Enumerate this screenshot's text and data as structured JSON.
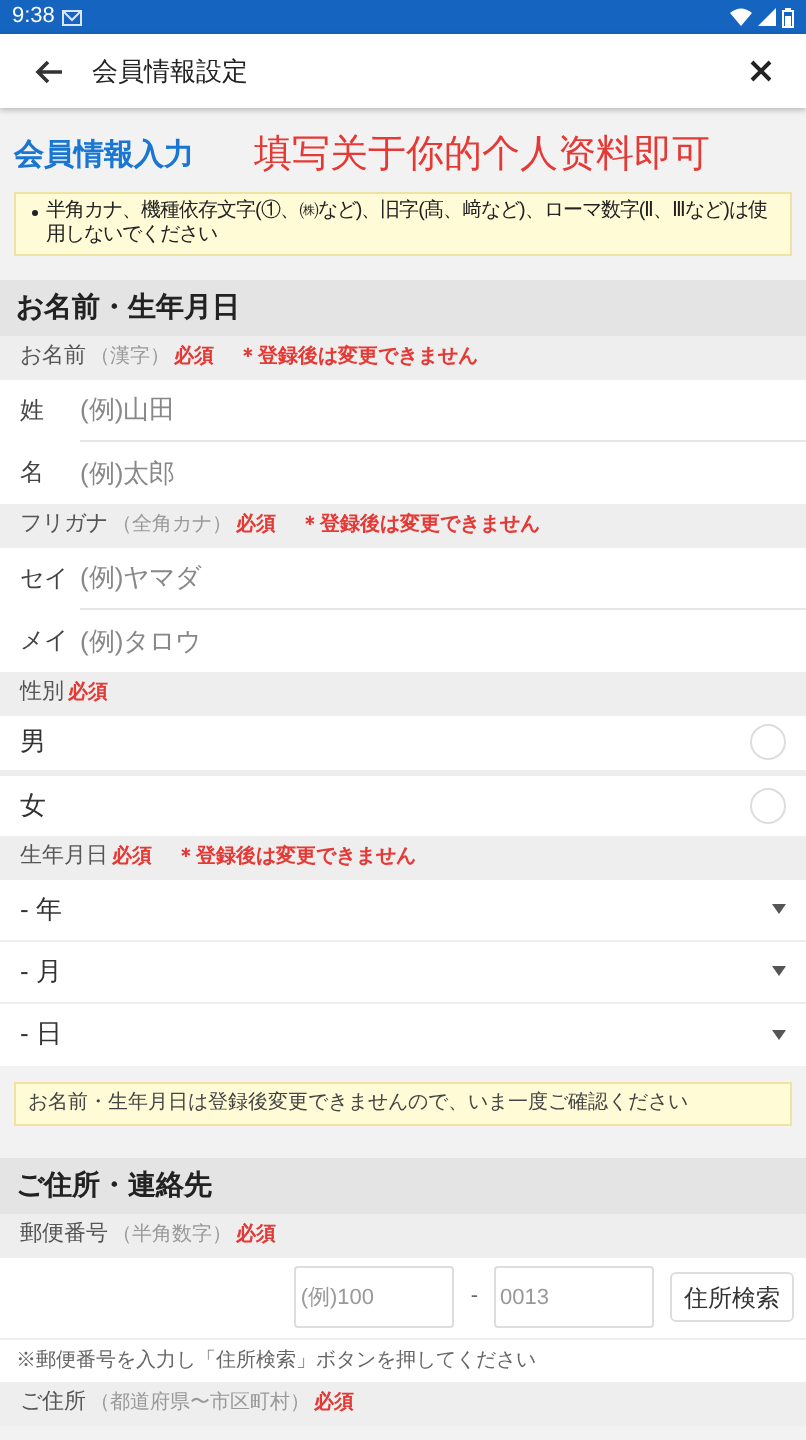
{
  "status_bar": {
    "time": "9:38"
  },
  "app_bar": {
    "title": "会員情報設定"
  },
  "page_title": "会員情報入力",
  "overlay_caption": "填写关于你的个人资料即可",
  "notice": "半角カナ、機種依存文字(①、㈱など)、旧字(髙、﨑など)、ローマ数字(Ⅱ、Ⅲなど)は使用しないでください",
  "sections": [
    {
      "title": "お名前・生年月日",
      "groups": [
        {
          "label": "お名前",
          "sub": "（漢字）",
          "required": "必須",
          "note": "＊登録後は変更できません",
          "kind": "text",
          "rows": [
            {
              "label": "姓",
              "placeholder": "(例)山田"
            },
            {
              "label": "名",
              "placeholder": "(例)太郎"
            }
          ]
        },
        {
          "label": "フリガナ",
          "sub": "（全角カナ）",
          "required": "必須",
          "note": "＊登録後は変更できません",
          "kind": "text",
          "rows": [
            {
              "label": "セイ",
              "placeholder": "(例)ヤマダ"
            },
            {
              "label": "メイ",
              "placeholder": "(例)タロウ"
            }
          ]
        },
        {
          "label": "性別",
          "required": "必須",
          "kind": "radio",
          "rows": [
            {
              "label": "男",
              "selected": false
            },
            {
              "label": "女",
              "selected": false
            }
          ]
        },
        {
          "label": "生年月日",
          "required": "必須",
          "note": "＊登録後は変更できません",
          "kind": "select",
          "rows": [
            {
              "label": "- 年"
            },
            {
              "label": "- 月"
            },
            {
              "label": "- 日"
            }
          ]
        }
      ],
      "footer_notice": "お名前・生年月日は登録後変更できませんので、いま一度ご確認ください"
    },
    {
      "title": "ご住所・連絡先",
      "groups": [
        {
          "label": "郵便番号",
          "sub": "（半角数字）",
          "required": "必須",
          "kind": "postal",
          "rows": [
            {
              "placeholder": "(例)100",
              "separator": "-",
              "placeholder2": "0013",
              "button": "住所検索"
            }
          ],
          "hint": "※郵便番号を入力し「住所検索」ボタンを押してください"
        },
        {
          "label": "ご住所",
          "sub": "（都道府県〜市区町村）",
          "required": "必須",
          "kind": "none"
        }
      ]
    }
  ]
}
